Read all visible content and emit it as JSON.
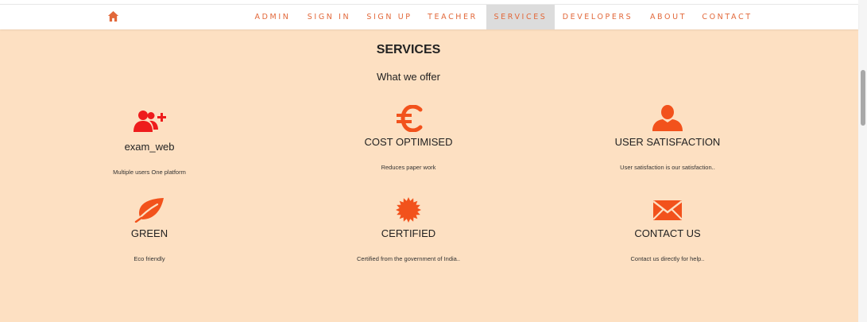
{
  "nav": {
    "items": [
      {
        "label": "ADMIN"
      },
      {
        "label": "SIGN IN"
      },
      {
        "label": "SIGN UP"
      },
      {
        "label": "TEACHER"
      },
      {
        "label": "SERVICES",
        "active": true
      },
      {
        "label": "DEVELOPERS"
      },
      {
        "label": "ABOUT"
      },
      {
        "label": "CONTACT"
      }
    ],
    "home_icon": "home-icon"
  },
  "section": {
    "title": "SERVICES",
    "subtitle": "What we offer"
  },
  "services": [
    {
      "icon": "user-add-icon",
      "title": "exam_web",
      "desc": "Multiple users One platform"
    },
    {
      "icon": "euro-icon",
      "title": "COST OPTIMISED",
      "desc": "Reduces paper work"
    },
    {
      "icon": "user-icon",
      "title": "USER SATISFACTION",
      "desc": "User satisfaction is our satisfaction.."
    },
    {
      "icon": "leaf-icon",
      "title": "GREEN",
      "desc": "Eco friendly"
    },
    {
      "icon": "certificate-icon",
      "title": "CERTIFIED",
      "desc": "Certified from the government of India.."
    },
    {
      "icon": "envelope-icon",
      "title": "CONTACT US",
      "desc": "Contact us directly for help.."
    }
  ],
  "colors": {
    "accent": "#e2683a",
    "icon": "#f2521c",
    "icon_red": "#ee1c1c",
    "background": "#fde0c2",
    "nav_active": "#dcdcdc"
  }
}
